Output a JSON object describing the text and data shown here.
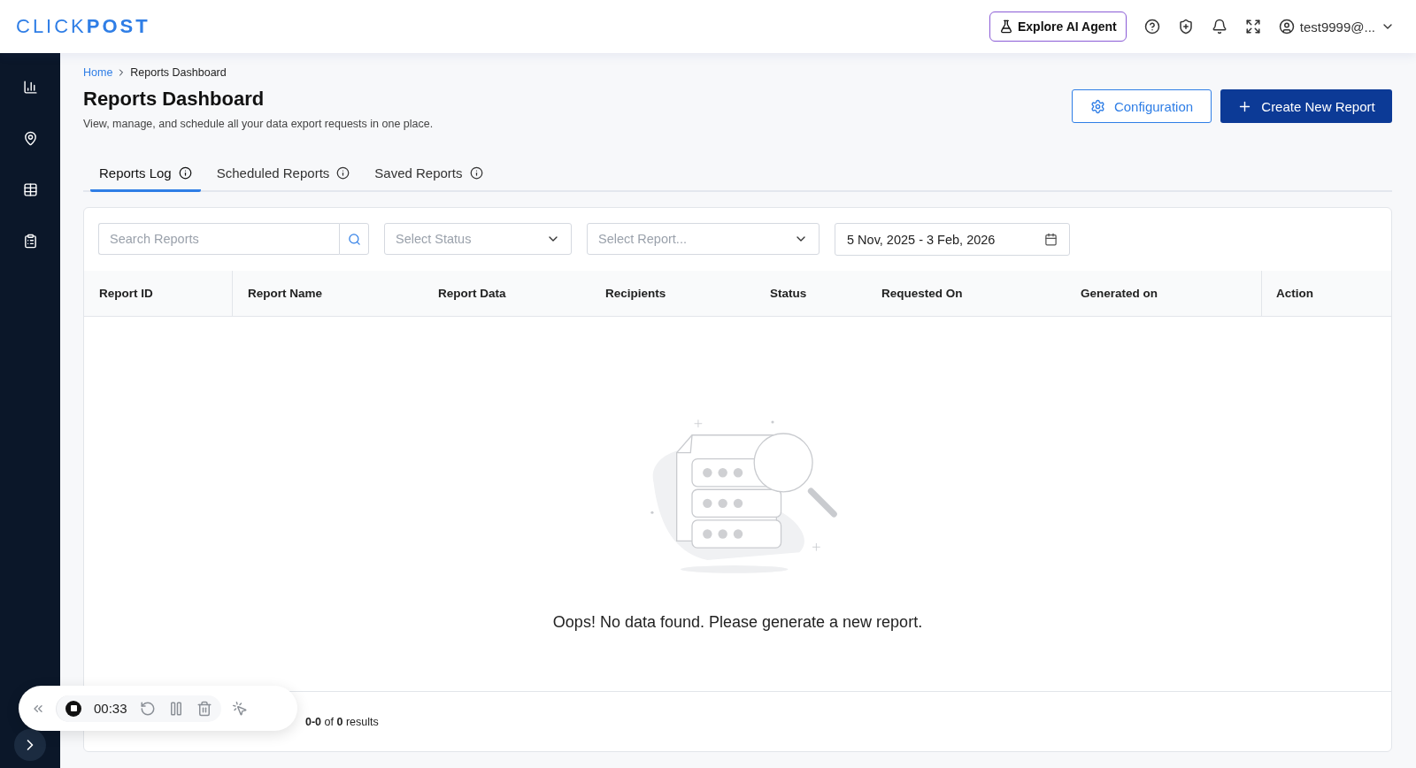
{
  "header": {
    "logo": "CLICK**POST**",
    "ai_button": "Explore AI Agent",
    "user": "test9999@..."
  },
  "breadcrumb": [
    "Home",
    "Reports Dashboard"
  ],
  "title": "Reports Dashboard",
  "subtitle": "View, manage, and schedule all your data export requests in one place.",
  "actions": {
    "configuration": "Configuration",
    "create": "Create New Report"
  },
  "tabs": [
    {
      "label": "Reports Log",
      "selected": true
    },
    {
      "label": "Scheduled Reports",
      "selected": false
    },
    {
      "label": "Saved Reports",
      "selected": false
    }
  ],
  "filters": {
    "search": {
      "placeholder": "Search Reports"
    },
    "status": {
      "placeholder": "Select Status"
    },
    "report": {
      "placeholder": "Select Report..."
    },
    "date_range": "5 Nov, 2025 - 3 Feb, 2026"
  },
  "table": {
    "columns": [
      "Report ID",
      "Report Name",
      "Report Data",
      "Recipients",
      "Status",
      "Requested On",
      "Generated on",
      "Action"
    ],
    "empty_message": "Oops! No data found. Please generate a new report."
  },
  "footer": {
    "results": "**0-0** of **0** results"
  },
  "recorder": {
    "time": "00:33"
  }
}
